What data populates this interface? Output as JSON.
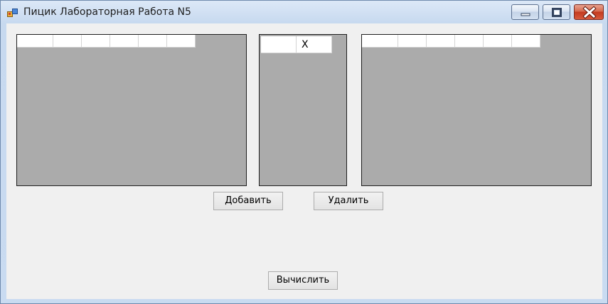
{
  "window": {
    "title": "Пицик Лабораторная Работа N5",
    "icon": "form-app-icon",
    "controls": [
      "minimize-icon",
      "maximize-icon",
      "close-icon"
    ]
  },
  "grids": {
    "left": {
      "header_cells": [
        "",
        "",
        "",
        "",
        "",
        ""
      ]
    },
    "middle": {
      "header_cells": [
        "",
        "X"
      ]
    },
    "right": {
      "header_cells": [
        "",
        "",
        "",
        "",
        "",
        ""
      ]
    }
  },
  "buttons": {
    "add_label": "Добавить",
    "delete_label": "Удалить",
    "compute_label": "Вычислить"
  },
  "colors": {
    "grid_background": "#ababab",
    "form_background": "#f0f0f0",
    "close_button": "#c33a1f"
  }
}
